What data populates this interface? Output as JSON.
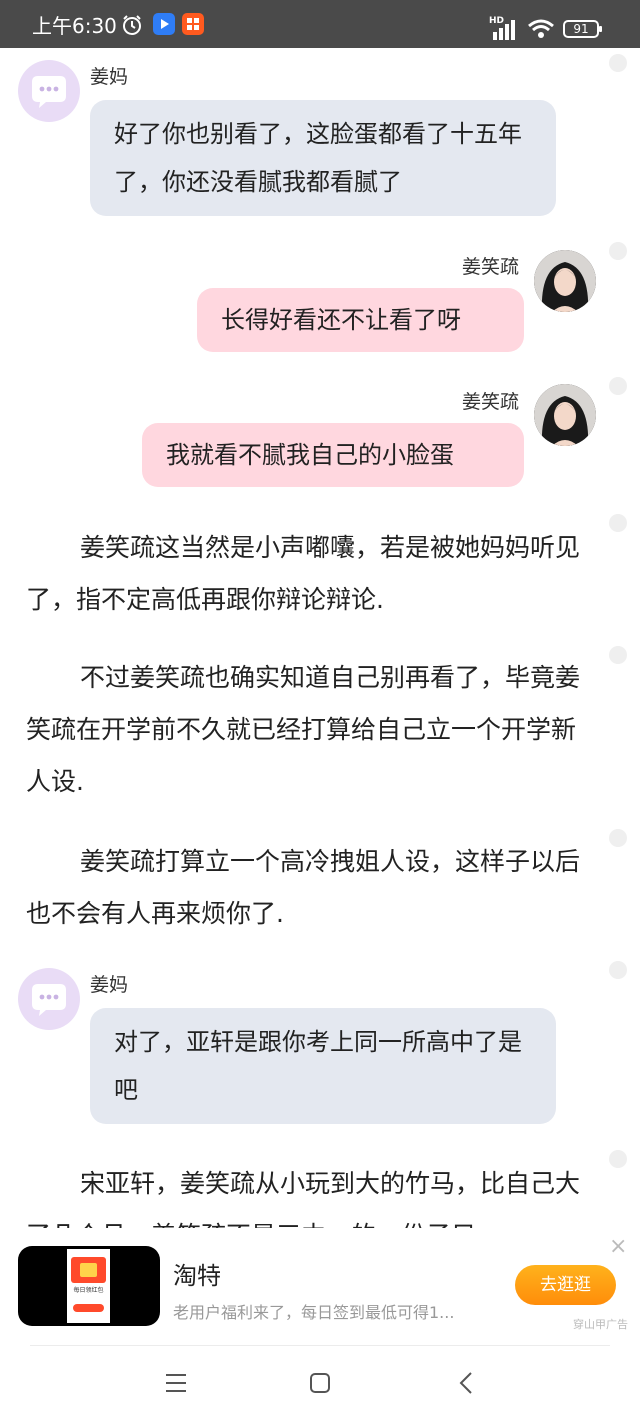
{
  "status_bar": {
    "time": "上午6:30",
    "network": "HD",
    "battery": "91",
    "icons": [
      "alarm-icon",
      "video-app-icon",
      "app-icon",
      "signal-icon",
      "wifi-icon",
      "battery-icon"
    ]
  },
  "chat": {
    "mom_name": "姜妈",
    "girl_name": "姜笑疏",
    "msg1": "好了你也别看了，这脸蛋都看了十五年了，你还没看腻我都看腻了",
    "msg2": "长得好看还不让看了呀",
    "msg3": "我就看不腻我自己的小脸蛋",
    "para1": "姜笑疏这当然是小声嘟囔，若是被她妈妈听见了，指不定高低再跟你辩论辩论.",
    "para2": "不过姜笑疏也确实知道自己别再看了，毕竟姜笑疏在开学前不久就已经打算给自己立一个开学新人设.",
    "para3": "姜笑疏打算立一个高冷拽姐人设，这样子以后也不会有人再来烦你了.",
    "msg4": "对了，亚轩是跟你考上同一所高中了是吧",
    "para4": "宋亚轩，姜笑疏从小玩到大的竹马，比自己大了几个月，姜笑疏不是三中一的一份子只"
  },
  "ad": {
    "title": "淘特",
    "description": "老用户福利来了，每日签到最低可得1...",
    "button": "去逛逛",
    "source": "穿山甲广告",
    "close": "×",
    "thumb_text": "每日领红包"
  },
  "nav": {
    "icons": [
      "menu-icon",
      "home-icon",
      "back-icon"
    ]
  },
  "colors": {
    "status_bar": "#4a4a4a",
    "left_bubble": "#e4e8f0",
    "right_bubble": "#ffd7df",
    "mom_avatar": "#e9dcf6",
    "ad_button": "#ff9a10"
  }
}
